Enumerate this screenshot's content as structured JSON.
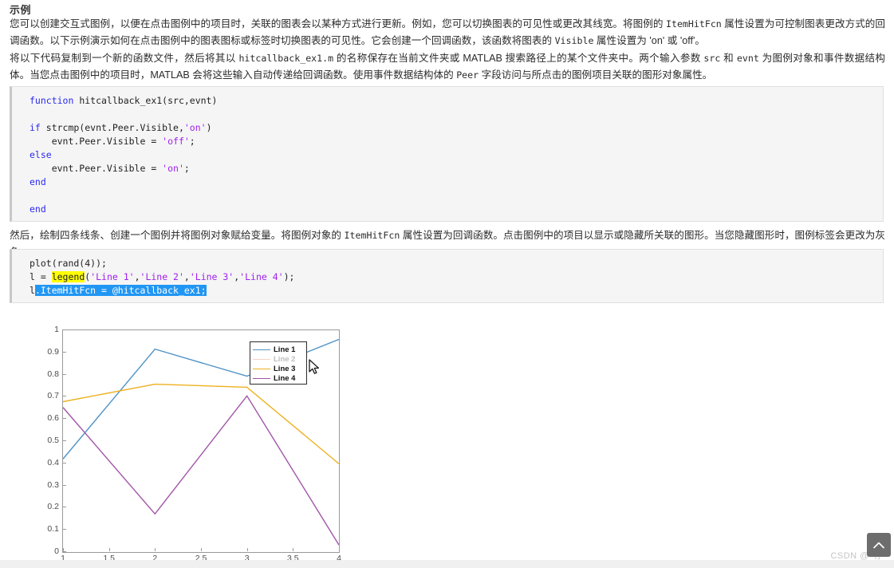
{
  "page": {
    "heading": "示例",
    "watermark": "CSDN @^存"
  },
  "paragraphs": {
    "intro_a": "您可以创建交互式图例，以便在点击图例中的项目时，关联的图表会以某种方式进行更新。例如，您可以切换图表的可见性或更改其线宽。将图例的 ",
    "intro_code1": "ItemHitFcn",
    "intro_b": " 属性设置为可控制图表更改方式的回调函数。以下示例演示如何在点击图例中的图表图标或标签时切换图表的可见性。它会创建一个回调函数，该函数将图表的 ",
    "intro_code2": "Visible",
    "intro_c": " 属性设置为 'on' 或 'off'。",
    "copy_a": "将以下代码复制到一个新的函数文件，然后将其以 ",
    "copy_code1": "hitcallback_ex1.m",
    "copy_b": " 的名称保存在当前文件夹或 MATLAB 搜索路径上的某个文件夹中。两个输入参数 ",
    "copy_code2": "src",
    "copy_c": " 和 ",
    "copy_code3": "evnt",
    "copy_d": " 为图例对象和事件数据结构体。当您点击图例中的项目时，MATLAB 会将这些输入自动传递给回调函数。使用事件数据结构体的 ",
    "copy_code4": "Peer",
    "copy_e": " 字段访问与所点击的图例项目关联的图形对象属性。",
    "then_a": "然后，绘制四条线条、创建一个图例并将图例对象赋给变量。将图例对象的 ",
    "then_code1": "ItemHitFcn",
    "then_b": " 属性设置为回调函数。点击图例中的项目以显示或隐藏所关联的图形。当您隐藏图形时，图例标签会更改为灰色。"
  },
  "code_callback": {
    "lines": [
      [
        {
          "t": "function",
          "c": "k"
        },
        {
          "t": " hitcallback_ex1(src,evnt)",
          "c": "plain"
        }
      ],
      [],
      [
        {
          "t": "if",
          "c": "k"
        },
        {
          "t": " strcmp(evnt.Peer.Visible,",
          "c": "plain"
        },
        {
          "t": "'on'",
          "c": "str"
        },
        {
          "t": ")",
          "c": "plain"
        }
      ],
      [
        {
          "t": "    evnt.Peer.Visible = ",
          "c": "plain"
        },
        {
          "t": "'off'",
          "c": "str"
        },
        {
          "t": ";",
          "c": "plain"
        }
      ],
      [
        {
          "t": "else",
          "c": "k"
        }
      ],
      [
        {
          "t": "    evnt.Peer.Visible = ",
          "c": "plain"
        },
        {
          "t": "'on'",
          "c": "str"
        },
        {
          "t": ";",
          "c": "plain"
        }
      ],
      [
        {
          "t": "end",
          "c": "k"
        }
      ],
      [],
      [
        {
          "t": "end",
          "c": "k"
        }
      ]
    ]
  },
  "code_plot": {
    "lines": [
      [
        {
          "t": "plot(rand(4));",
          "c": "plain"
        }
      ],
      [
        {
          "t": "l = ",
          "c": "plain"
        },
        {
          "t": "legend",
          "c": "hl-yellow"
        },
        {
          "t": "(",
          "c": "plain"
        },
        {
          "t": "'Line 1'",
          "c": "str"
        },
        {
          "t": ",",
          "c": "plain"
        },
        {
          "t": "'Line 2'",
          "c": "str"
        },
        {
          "t": ",",
          "c": "plain"
        },
        {
          "t": "'Line 3'",
          "c": "str"
        },
        {
          "t": ",",
          "c": "plain"
        },
        {
          "t": "'Line 4'",
          "c": "str"
        },
        {
          "t": ");",
          "c": "plain"
        }
      ],
      [
        {
          "t": "l",
          "c": "plain"
        },
        {
          "t": ".ItemHitFcn = @hitcallback_ex1;",
          "c": "hl-select"
        }
      ]
    ]
  },
  "chart_data": {
    "type": "line",
    "title": "",
    "xlabel": "",
    "ylabel": "",
    "xlim": [
      1,
      4
    ],
    "ylim": [
      0,
      1
    ],
    "grid": false,
    "legend_position": "northeast",
    "xticks": [
      "1",
      "1.5",
      "2",
      "2.5",
      "3",
      "3.5",
      "4"
    ],
    "xtick_values": [
      1,
      1.5,
      2,
      2.5,
      3,
      3.5,
      4
    ],
    "yticks": [
      "0",
      "0.1",
      "0.2",
      "0.3",
      "0.4",
      "0.5",
      "0.6",
      "0.7",
      "0.8",
      "0.9",
      "1"
    ],
    "ytick_values": [
      0,
      0.1,
      0.2,
      0.3,
      0.4,
      0.5,
      0.6,
      0.7,
      0.8,
      0.9,
      1
    ],
    "x": [
      1,
      2,
      3,
      4
    ],
    "series": [
      {
        "name": "Line 1",
        "values": [
          0.42,
          0.915,
          0.793,
          0.959
        ],
        "color": "#4e93c6",
        "visible": true
      },
      {
        "name": "Line 2",
        "values": [
          null,
          null,
          null,
          null
        ],
        "color": "#f2a07b",
        "visible": false
      },
      {
        "name": "Line 3",
        "values": [
          0.678,
          0.757,
          0.743,
          0.398
        ],
        "color": "#edb120",
        "visible": true
      },
      {
        "name": "Line 4",
        "values": [
          0.652,
          0.172,
          0.704,
          0.032
        ],
        "color": "#a255a8",
        "visible": true
      }
    ]
  },
  "controls": {
    "scroll_top_label": "scroll-to-top"
  }
}
